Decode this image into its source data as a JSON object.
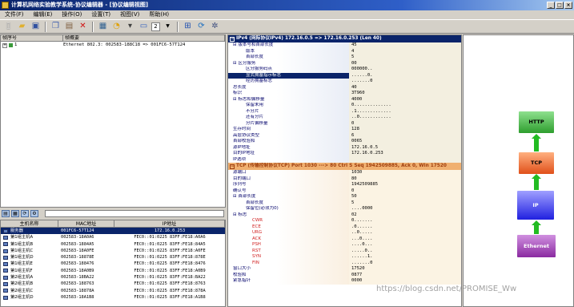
{
  "window": {
    "title": "计算机网络实验教学系统-协议编辑器 - [协议编辑视图]",
    "buttons": [
      "_",
      "□",
      "×"
    ]
  },
  "menu": [
    "文件(F)",
    "编辑(E)",
    "操作(O)",
    "设置(T)",
    "视图(V)",
    "帮助(H)"
  ],
  "toolbar": {
    "icons": [
      "new-icon",
      "open-icon",
      "save-icon",
      "copy-icon",
      "paste-icon",
      "delete-icon",
      "calculator-icon",
      "send-icon",
      "receive-icon",
      "list-icon",
      "counter-icon",
      "network-icon",
      "refresh-icon",
      "settings-icon"
    ],
    "counter_value": "2"
  },
  "frames": {
    "headers": [
      "帧序号",
      "帧概要"
    ],
    "rows": [
      {
        "index": "1",
        "summary": "Ethernet 802.3: 002583-188C18 => 001FC6-57T124"
      }
    ]
  },
  "hosts": {
    "headers": [
      "主机名称",
      "MAC地址",
      "IP地址"
    ],
    "rows": [
      {
        "name": "服务器",
        "mac": "001FC6-57T124",
        "ip": "172.16.0.253",
        "selected": true
      },
      {
        "name": "第1组主机A",
        "mac": "002583-18A0A6",
        "ip": "FEC0::01:0225 83FF:FE18:A0A6",
        "selected": false
      },
      {
        "name": "第1组主机B",
        "mac": "002583-1884A5",
        "ip": "FEC0::01:0225 83FF:FE18:84A5",
        "selected": false
      },
      {
        "name": "第1组主机C",
        "mac": "002583-18A0FE",
        "ip": "FEC0::01:0225 83FF:FE18:A0FE",
        "selected": false
      },
      {
        "name": "第1组主机D",
        "mac": "002583-18878E",
        "ip": "FEC0::01:0225 83FF:FE18:878E",
        "selected": false
      },
      {
        "name": "第1组主机E",
        "mac": "002583-188476",
        "ip": "FEC0::01:0225 83FF:FE18:8476",
        "selected": false
      },
      {
        "name": "第1组主机F",
        "mac": "002583-18A0B9",
        "ip": "FEC0::01:0225 83FF:FE18:A0B9",
        "selected": false
      },
      {
        "name": "第2组主机A",
        "mac": "002583-18BA22",
        "ip": "FEC0::01:0225 83FF:FE18:BA22",
        "selected": false
      },
      {
        "name": "第2组主机B",
        "mac": "002583-188763",
        "ip": "FEC0::01:0225 83FF:FE18:8763",
        "selected": false
      },
      {
        "name": "第2组主机C",
        "mac": "002583-18878A",
        "ip": "FEC0::01:0225 83FF:FE18:878A",
        "selected": false
      },
      {
        "name": "第2组主机D",
        "mac": "002583-18A1B8",
        "ip": "FEC0::01:0225 83FF:FE18:A1B8",
        "selected": false
      }
    ]
  },
  "ip_section": {
    "header": "IPv4 (网际协议IPv4) 172.16.0.5 => 172.16.0.253 (Len 40)",
    "fields": [
      {
        "name": "⊟ 版本号和首部长度",
        "value": "45",
        "indent": 0,
        "style": ""
      },
      {
        "name": "版本",
        "value": "4",
        "indent": 2,
        "style": ""
      },
      {
        "name": "首部长度",
        "value": "5",
        "indent": 2,
        "style": ""
      },
      {
        "name": "⊟ 区分服务",
        "value": "00",
        "indent": 0,
        "style": ""
      },
      {
        "name": "区分服务码点",
        "value": "000000..",
        "indent": 2,
        "style": ""
      },
      {
        "name": "显式拥塞指示标志",
        "value": "......0.",
        "indent": 2,
        "style": "hl"
      },
      {
        "name": "经历拥塞标志",
        "value": ".......0",
        "indent": 2,
        "style": ""
      },
      {
        "name": "总长度",
        "value": "40",
        "indent": 0,
        "style": ""
      },
      {
        "name": "标识",
        "value": "3T960",
        "indent": 0,
        "style": ""
      },
      {
        "name": "⊟ 标志和偏移量",
        "value": "4000",
        "indent": 0,
        "style": ""
      },
      {
        "name": "保留未用",
        "value": "0..............",
        "indent": 2,
        "style": ""
      },
      {
        "name": "不分片",
        "value": ".1.............",
        "indent": 2,
        "style": ""
      },
      {
        "name": "还有分片",
        "value": "..0............",
        "indent": 2,
        "style": ""
      },
      {
        "name": "分片偏移量",
        "value": "0",
        "indent": 2,
        "style": ""
      },
      {
        "name": "生存时间",
        "value": "128",
        "indent": 0,
        "style": ""
      },
      {
        "name": "高层协议类型",
        "value": "6",
        "indent": 0,
        "style": ""
      },
      {
        "name": "首部校验和",
        "value": "0065",
        "indent": 0,
        "style": ""
      },
      {
        "name": "源IP地址",
        "value": "172.16.0.5",
        "indent": 0,
        "style": ""
      },
      {
        "name": "目的IP地址",
        "value": "172.16.0.253",
        "indent": 0,
        "style": ""
      },
      {
        "name": "IP选项",
        "value": "",
        "indent": 0,
        "style": ""
      }
    ]
  },
  "tcp_section": {
    "header": "TCP (传输控制协议TCP) Port 1030 ---> 80 Ctrl S Seq 1942509885, Ack 0, Win 17520",
    "fields": [
      {
        "name": "源端口",
        "value": "1030",
        "indent": 0,
        "style": ""
      },
      {
        "name": "目的端口",
        "value": "80",
        "indent": 0,
        "style": ""
      },
      {
        "name": "序列号",
        "value": "1942509885",
        "indent": 0,
        "style": ""
      },
      {
        "name": "确认号",
        "value": "0",
        "indent": 0,
        "style": ""
      },
      {
        "name": "⊟ 首部长度",
        "value": "50",
        "indent": 0,
        "style": ""
      },
      {
        "name": "首部长度",
        "value": "5",
        "indent": 2,
        "style": ""
      },
      {
        "name": "保留位(必须为0)",
        "value": "....0000",
        "indent": 2,
        "style": ""
      },
      {
        "name": "⊟ 标志",
        "value": "02",
        "indent": 0,
        "style": ""
      },
      {
        "name": "CWR",
        "value": "0.......",
        "indent": 3,
        "style": "red"
      },
      {
        "name": "ECE",
        "value": ".0......",
        "indent": 3,
        "style": "red"
      },
      {
        "name": "URG",
        "value": "..0.....",
        "indent": 3,
        "style": "red"
      },
      {
        "name": "ACK",
        "value": "...0....",
        "indent": 3,
        "style": "red"
      },
      {
        "name": "PSH",
        "value": "....0...",
        "indent": 3,
        "style": "red"
      },
      {
        "name": "RST",
        "value": ".....0..",
        "indent": 3,
        "style": "red"
      },
      {
        "name": "SYN",
        "value": "......1.",
        "indent": 3,
        "style": "red"
      },
      {
        "name": "FIN",
        "value": ".......0",
        "indent": 3,
        "style": "red"
      },
      {
        "name": "窗口大小",
        "value": "17520",
        "indent": 0,
        "style": ""
      },
      {
        "name": "校验和",
        "value": "0877",
        "indent": 0,
        "style": ""
      },
      {
        "name": "紧急指针",
        "value": "0000",
        "indent": 0,
        "style": ""
      }
    ]
  },
  "stack": {
    "layers": [
      "HTTP",
      "TCP",
      "IP",
      "Ethernet"
    ]
  },
  "watermark": "https://blog.csdn.net/PROMISE_Ww"
}
